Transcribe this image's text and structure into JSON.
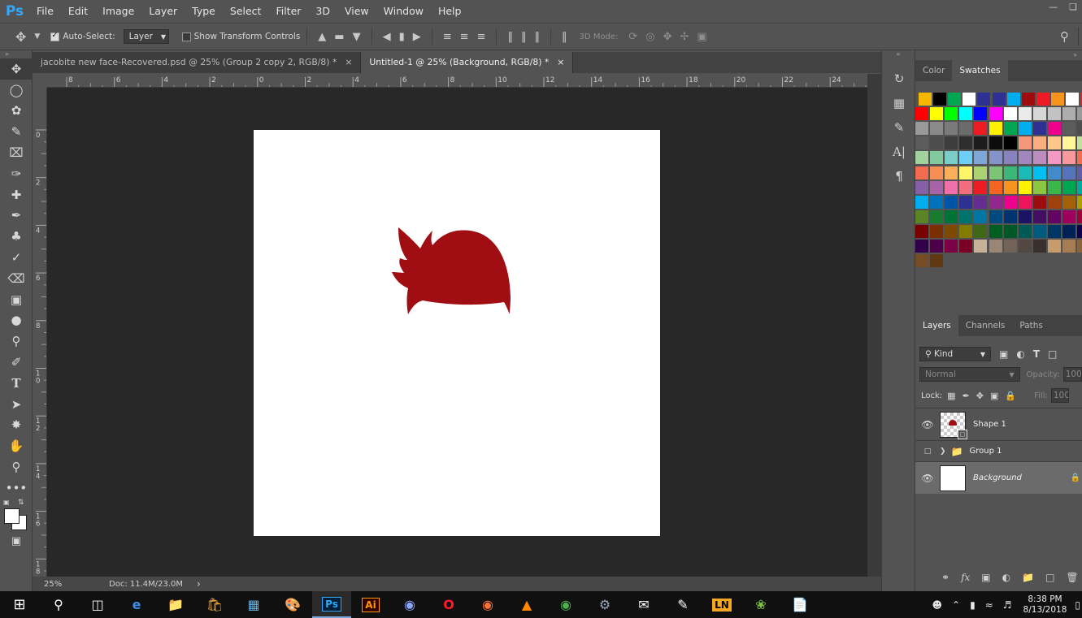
{
  "menu": [
    "File",
    "Edit",
    "Image",
    "Layer",
    "Type",
    "Select",
    "Filter",
    "3D",
    "View",
    "Window",
    "Help"
  ],
  "app_logo": "Ps",
  "options": {
    "auto_select_label": "Auto-Select:",
    "auto_select_value": "Layer",
    "transform_label": "Show Transform Controls",
    "mode3d_label": "3D Mode:"
  },
  "tabs": [
    {
      "label": "jacobite new face-Recovered.psd @ 25% (Group 2 copy 2, RGB/8) *",
      "close": "×"
    },
    {
      "label": "Untitled-1 @ 25% (Background, RGB/8) *",
      "close": "×"
    }
  ],
  "ruler_top_labels": [
    "8",
    "6",
    "4",
    "2",
    "0",
    "2",
    "4",
    "6",
    "8",
    "10",
    "12",
    "14",
    "16",
    "18",
    "20",
    "22",
    "24"
  ],
  "ruler_left_labels": [
    "0",
    "2",
    "4",
    "6",
    "8",
    "10",
    "12",
    "14",
    "16",
    "18"
  ],
  "status": {
    "zoom": "25%",
    "doc": "Doc: 11.4M/23.0M",
    "arrow": "›"
  },
  "panels": {
    "color_tab": "Color",
    "swatches_tab": "Swatches",
    "layers_tab": "Layers",
    "channels_tab": "Channels",
    "paths_tab": "Paths",
    "kind_label": "Kind",
    "blend_mode": "Normal",
    "opacity_label": "Opacity:",
    "opacity_value": "100",
    "lock_label": "Lock:",
    "fill_label": "Fill:",
    "fill_value": "100"
  },
  "layers": [
    {
      "name": "Shape 1"
    },
    {
      "name": "Group 1"
    },
    {
      "name": "Background"
    }
  ],
  "clock": {
    "time": "8:38 PM",
    "date": "8/13/2018"
  },
  "colors": {
    "shape_fill": "#a00d12",
    "ui_bg": "#535353",
    "workspace_bg": "#282828"
  },
  "swatch_rows": [
    [
      "#f5b700",
      "#000000",
      "#00a651",
      "#ffffff",
      "#2e3192",
      "#2e3192",
      "#00aeef",
      "#9e0b0f",
      "#ed1c24",
      "#f7941d",
      "#ffffff",
      "#ed1c24",
      "#0072bc"
    ],
    [
      "#ff0000",
      "#ffff00",
      "#00ff00",
      "#00ffff",
      "#0000ff",
      "#ff00ff",
      "#ffffff",
      "#ebebeb",
      "#d7d7d7",
      "#c2c2c2",
      "#adadad",
      "#999999"
    ],
    [
      "#999999",
      "#8a8a8a",
      "#7a7a7a",
      "#6b6b6b",
      "#ed1c24",
      "#fff200",
      "#00a651",
      "#00aeef",
      "#2e3192",
      "#ec008c",
      "#5c5c5c",
      "#4d4d4d"
    ],
    [
      "#5c5c5c",
      "#4d4d4d",
      "#3d3d3d",
      "#2e2e2e",
      "#1c1c1c",
      "#0d0d0d",
      "#000000",
      "#f7977a",
      "#f9ad81",
      "#fdc68a",
      "#fff799",
      "#c4df9b"
    ],
    [
      "#a3d39c",
      "#82ca9d",
      "#7bcdc8",
      "#6dcff6",
      "#7ea7d8",
      "#8493ca",
      "#8882be",
      "#a187be",
      "#bc8dbf",
      "#f49ac2",
      "#f6989d",
      "#f26c4f"
    ],
    [
      "#f26c4f",
      "#f68e56",
      "#fbaf5d",
      "#fff568",
      "#acd373",
      "#7cc576",
      "#3bb878",
      "#1abbb4",
      "#00bff3",
      "#438ccb",
      "#5574b9",
      "#605ca8"
    ],
    [
      "#855fa8",
      "#a763a8",
      "#f06eaa",
      "#f26d7d",
      "#ed1c24",
      "#f26522",
      "#f7941d",
      "#fff200",
      "#8dc73f",
      "#39b54a",
      "#00a651",
      "#00a99d"
    ],
    [
      "#00aeef",
      "#0072bc",
      "#0054a6",
      "#2e3192",
      "#662d91",
      "#92278f",
      "#ec008c",
      "#ed145b",
      "#9e0b0f",
      "#a0410d",
      "#a36209",
      "#aba000"
    ],
    [
      "#598527",
      "#197b30",
      "#007236",
      "#00746b",
      "#0076a3",
      "#004a80",
      "#003471",
      "#1b1464",
      "#440e62",
      "#630460",
      "#9e005d",
      "#9e0039"
    ],
    [
      "#790000",
      "#7b2e00",
      "#7d4900",
      "#827b00",
      "#406618",
      "#005e20",
      "#005826",
      "#005952",
      "#005b7f",
      "#003663",
      "#002157",
      "#0d004c"
    ],
    [
      "#32004b",
      "#4b0049",
      "#7b0046",
      "#7a0026",
      "#c7b299",
      "#998675",
      "#736357",
      "#534741",
      "#37302d",
      "#c69c6d",
      "#a67c52",
      "#8c6239"
    ],
    [
      "#754c24",
      "#603913"
    ]
  ]
}
